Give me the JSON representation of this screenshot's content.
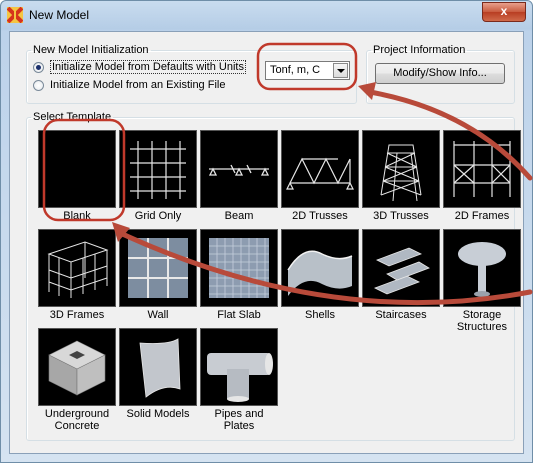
{
  "window": {
    "title": "New Model",
    "close_label": "x"
  },
  "init_group": {
    "legend": "New Model Initialization",
    "option_defaults": "Initialize Model from Defaults with Units",
    "option_existing": "Initialize Model  from an Existing File",
    "units_value": "Tonf, m, C"
  },
  "project_group": {
    "legend": "Project Information",
    "modify_button": "Modify/Show Info..."
  },
  "templates": {
    "legend": "Select Template",
    "items": [
      {
        "label": "Blank",
        "icon": "blank-icon"
      },
      {
        "label": "Grid Only",
        "icon": "grid-icon"
      },
      {
        "label": "Beam",
        "icon": "beam-icon"
      },
      {
        "label": "2D Trusses",
        "icon": "truss-2d-icon"
      },
      {
        "label": "3D Trusses",
        "icon": "truss-3d-icon"
      },
      {
        "label": "2D Frames",
        "icon": "frame-2d-icon"
      },
      {
        "label": "3D Frames",
        "icon": "frame-3d-icon"
      },
      {
        "label": "Wall",
        "icon": "wall-icon"
      },
      {
        "label": "Flat Slab",
        "icon": "flat-slab-icon"
      },
      {
        "label": "Shells",
        "icon": "shell-icon"
      },
      {
        "label": "Staircases",
        "icon": "staircase-icon"
      },
      {
        "label": "Storage\nStructures",
        "icon": "storage-icon"
      },
      {
        "label": "Underground\nConcrete",
        "icon": "underground-icon"
      },
      {
        "label": "Solid Models",
        "icon": "solid-icon"
      },
      {
        "label": "Pipes and\nPlates",
        "icon": "pipe-icon"
      }
    ]
  },
  "colors": {
    "annotation_red": "#c0392b",
    "thumbnail_bg": "#000000"
  }
}
